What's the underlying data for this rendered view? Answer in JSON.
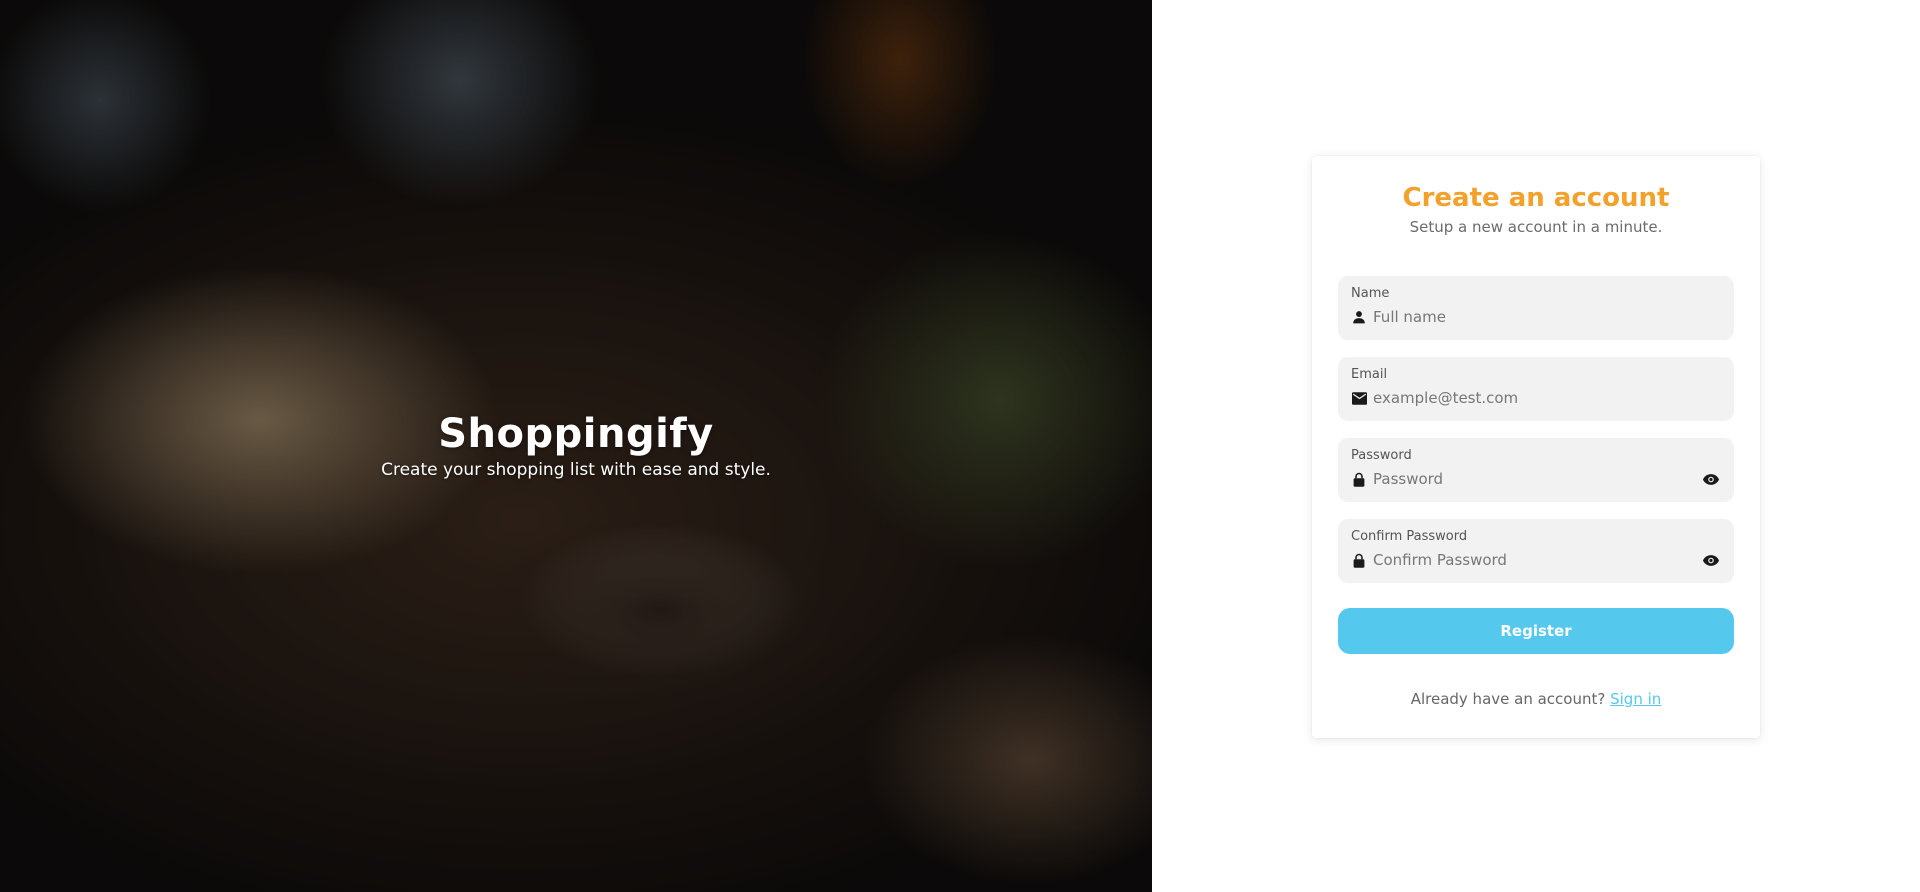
{
  "hero": {
    "title": "Shoppingify",
    "subtitle": "Create your shopping list with ease and style."
  },
  "form": {
    "title": "Create an account",
    "subtitle": "Setup a new account in a minute.",
    "fields": [
      {
        "label": "Name",
        "placeholder": "Full name",
        "icon": "person-icon",
        "value": ""
      },
      {
        "label": "Email",
        "placeholder": "example@test.com",
        "icon": "mail-icon",
        "value": ""
      },
      {
        "label": "Password",
        "placeholder": "Password",
        "icon": "lock-icon",
        "value": ""
      },
      {
        "label": "Confirm Password",
        "placeholder": "Confirm Password",
        "icon": "lock-icon",
        "value": ""
      }
    ],
    "register_label": "Register",
    "signin_prompt": "Already have an account?",
    "signin_link": "Sign in"
  },
  "colors": {
    "accent_orange": "#f2a12b",
    "accent_blue": "#55c8ee",
    "field_bg": "#f2f2f2"
  }
}
